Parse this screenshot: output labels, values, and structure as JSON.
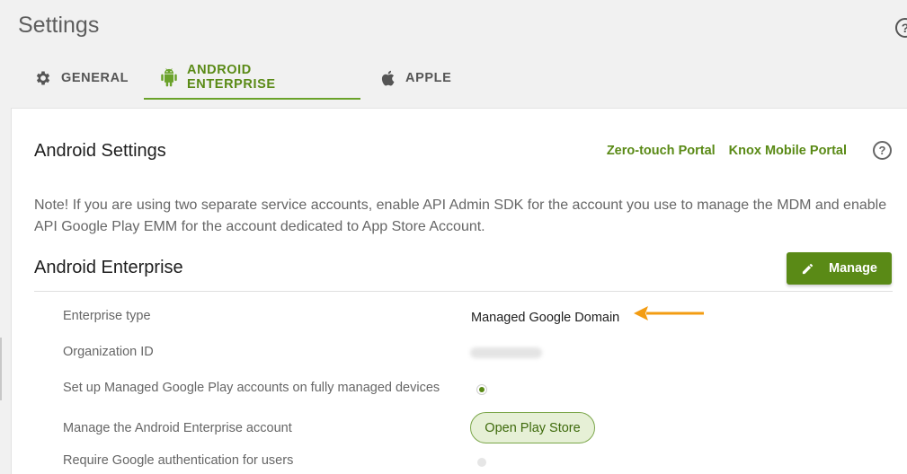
{
  "page": {
    "title": "Settings"
  },
  "tabs": [
    {
      "label": "GENERAL",
      "icon": "gear-icon",
      "active": false
    },
    {
      "label": "ANDROID ENTERPRISE",
      "icon": "android-icon",
      "active": true
    },
    {
      "label": "APPLE",
      "icon": "apple-icon",
      "active": false
    }
  ],
  "android_settings": {
    "title": "Android Settings",
    "links": [
      "Zero-touch Portal",
      "Knox Mobile Portal"
    ],
    "note": "Note! If you are using two separate service accounts, enable API Admin SDK for the account you use to manage the MDM and enable API Google Play EMM for the account dedicated to App Store Account."
  },
  "android_enterprise": {
    "title": "Android Enterprise",
    "manage_label": "Manage",
    "rows": {
      "enterprise_type": {
        "label": "Enterprise type",
        "value": "Managed Google Domain"
      },
      "organization_id": {
        "label": "Organization ID"
      },
      "managed_play_accounts": {
        "label": "Set up Managed Google Play accounts on fully managed devices",
        "enabled": true
      },
      "manage_account": {
        "label": "Manage the Android Enterprise account",
        "button": "Open Play Store"
      },
      "require_google_auth": {
        "label": "Require Google authentication for users",
        "enabled": false
      }
    }
  },
  "colors": {
    "accent": "#5a8a16",
    "arrow": "#f39c12"
  }
}
